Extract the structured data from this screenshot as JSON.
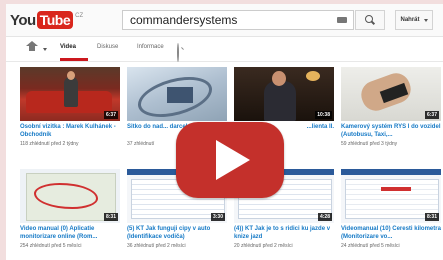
{
  "header": {
    "logo_you": "You",
    "logo_tube": "Tube",
    "logo_region": "CZ",
    "search_query": "commandersystems",
    "upload_label": "Nahrát"
  },
  "nav": {
    "tabs": [
      {
        "label": "Videa",
        "active": true
      },
      {
        "label": "Diskuse",
        "active": false
      },
      {
        "label": "Informace",
        "active": false
      }
    ]
  },
  "videos": [
    {
      "title": "Osobní vizitka : Marek Kulhánek - Obchodník",
      "meta": "118 zhlédnutí   před 2 týdny",
      "duration": "6:37"
    },
    {
      "title": "Sitko do nad... darcek pre...",
      "meta": "37 zhlédnutí",
      "duration": ""
    },
    {
      "title": "...lienta II.",
      "meta": "",
      "duration": "10:38"
    },
    {
      "title": "Kamerový systém RYS I do vozidel (Autobusu, Taxi,...",
      "meta": "59 zhlédnutí   před 3 týdny",
      "duration": "6:37"
    },
    {
      "title": "Video manual (0) Aplicatie monitorizare online (Rom...",
      "meta": "254 zhlédnutí   před 5 měsíci",
      "duration": "8:31"
    },
    {
      "title": "(5) KT Jak funguji cipy v auto (Identifikace vodiča)",
      "meta": "36 zhlédnutí   před 2 měsíci",
      "duration": "3:30"
    },
    {
      "title": "(4)) KT Jak je to s ridici ku jazde v knize jazd",
      "meta": "20 zhlédnutí   před 2 měsíci",
      "duration": "4:28"
    },
    {
      "title": "Videomanual (10) Ceresti kilometra (Monitorizare vo...",
      "meta": "24 zhlédnutí   před 5 měsíci",
      "duration": "8:31"
    }
  ],
  "colors": {
    "accent": "#cc181e",
    "link": "#167ac6",
    "play": "#c4302b"
  }
}
